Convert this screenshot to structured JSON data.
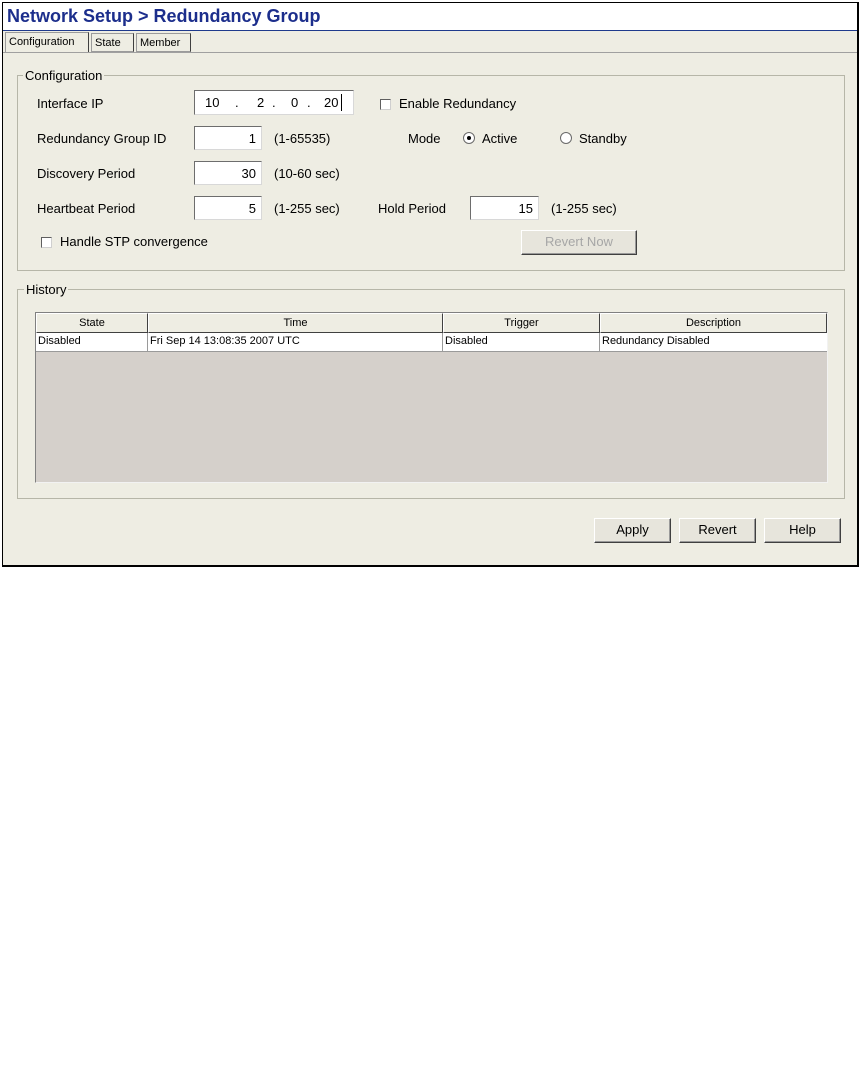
{
  "title": "Network Setup > Redundancy Group",
  "tabs": [
    {
      "label": "Configuration",
      "active": true
    },
    {
      "label": "State",
      "active": false
    },
    {
      "label": "Member",
      "active": false
    }
  ],
  "configuration": {
    "legend": "Configuration",
    "interface_ip": {
      "label": "Interface IP",
      "octets": [
        "10",
        "2",
        "0",
        "20"
      ]
    },
    "enable_redundancy": {
      "label": "Enable Redundancy",
      "checked": false
    },
    "group_id": {
      "label": "Redundancy Group ID",
      "value": "1",
      "range": "(1-65535)"
    },
    "mode": {
      "label": "Mode",
      "active_label": "Active",
      "standby_label": "Standby",
      "selected": "Active"
    },
    "discovery": {
      "label": "Discovery Period",
      "value": "30",
      "range": "(10-60 sec)"
    },
    "heartbeat": {
      "label": "Heartbeat Period",
      "value": "5",
      "range": "(1-255 sec)"
    },
    "hold": {
      "label": "Hold Period",
      "value": "15",
      "range": "(1-255 sec)"
    },
    "stp": {
      "label": "Handle STP convergence",
      "checked": false
    },
    "revert_now": {
      "label": "Revert Now",
      "enabled": false
    }
  },
  "history": {
    "legend": "History",
    "columns": [
      "State",
      "Time",
      "Trigger",
      "Description"
    ],
    "rows": [
      [
        "Disabled",
        "Fri Sep 14 13:08:35 2007 UTC",
        "Disabled",
        "Redundancy Disabled"
      ]
    ]
  },
  "buttons": {
    "apply": "Apply",
    "revert": "Revert",
    "help": "Help"
  }
}
